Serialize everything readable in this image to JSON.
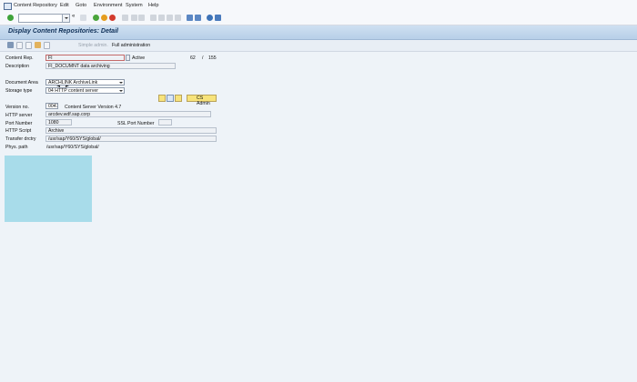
{
  "menu": {
    "items": [
      "Content Repository",
      "Edit",
      "Goto",
      "Environment",
      "System",
      "Help"
    ]
  },
  "title": "Display Content Repositories: Detail",
  "toolbar2": {
    "simple_admin": "Simple admin.",
    "full_admin": "Full administration"
  },
  "form": {
    "content_rep_label": "Content Rep.",
    "content_rep_value": "FI",
    "status": "Active",
    "counter_current": "62",
    "counter_sep": "/",
    "counter_total": "155",
    "description_label": "Description",
    "description_value": "FI_DOCUMNT data archiving",
    "document_area_label": "Document Area",
    "document_area_value": "ARCHLINK ArchiveLink",
    "storage_type_label": "Storage type",
    "storage_type_value": "04 HTTP content server",
    "cs_admin_label": "CS Admin",
    "version_label": "Version no.",
    "version_value": "0047",
    "version_text": "Content Server Version 4.7",
    "http_server_label": "HTTP server",
    "http_server_value": "arcdev.wdf.sap.corp",
    "port_label": "Port Number",
    "port_value": "1080",
    "ssl_port_label": "SSL Port Number",
    "ssl_port_value": "",
    "http_script_label": "HTTP Script",
    "http_script_value": "Archive",
    "transfer_label": "Transfer drctry",
    "transfer_value": "/usr/sap/Y60/SYS/global/",
    "phys_path_label": "Phys. path",
    "phys_path_value": "/usr/sap/Y60/SYS/global/"
  },
  "colors": {
    "title_bg": "#b7cfe8",
    "image_placeholder": "#a8dcea",
    "cs_admin_button": "#f7e37b"
  }
}
